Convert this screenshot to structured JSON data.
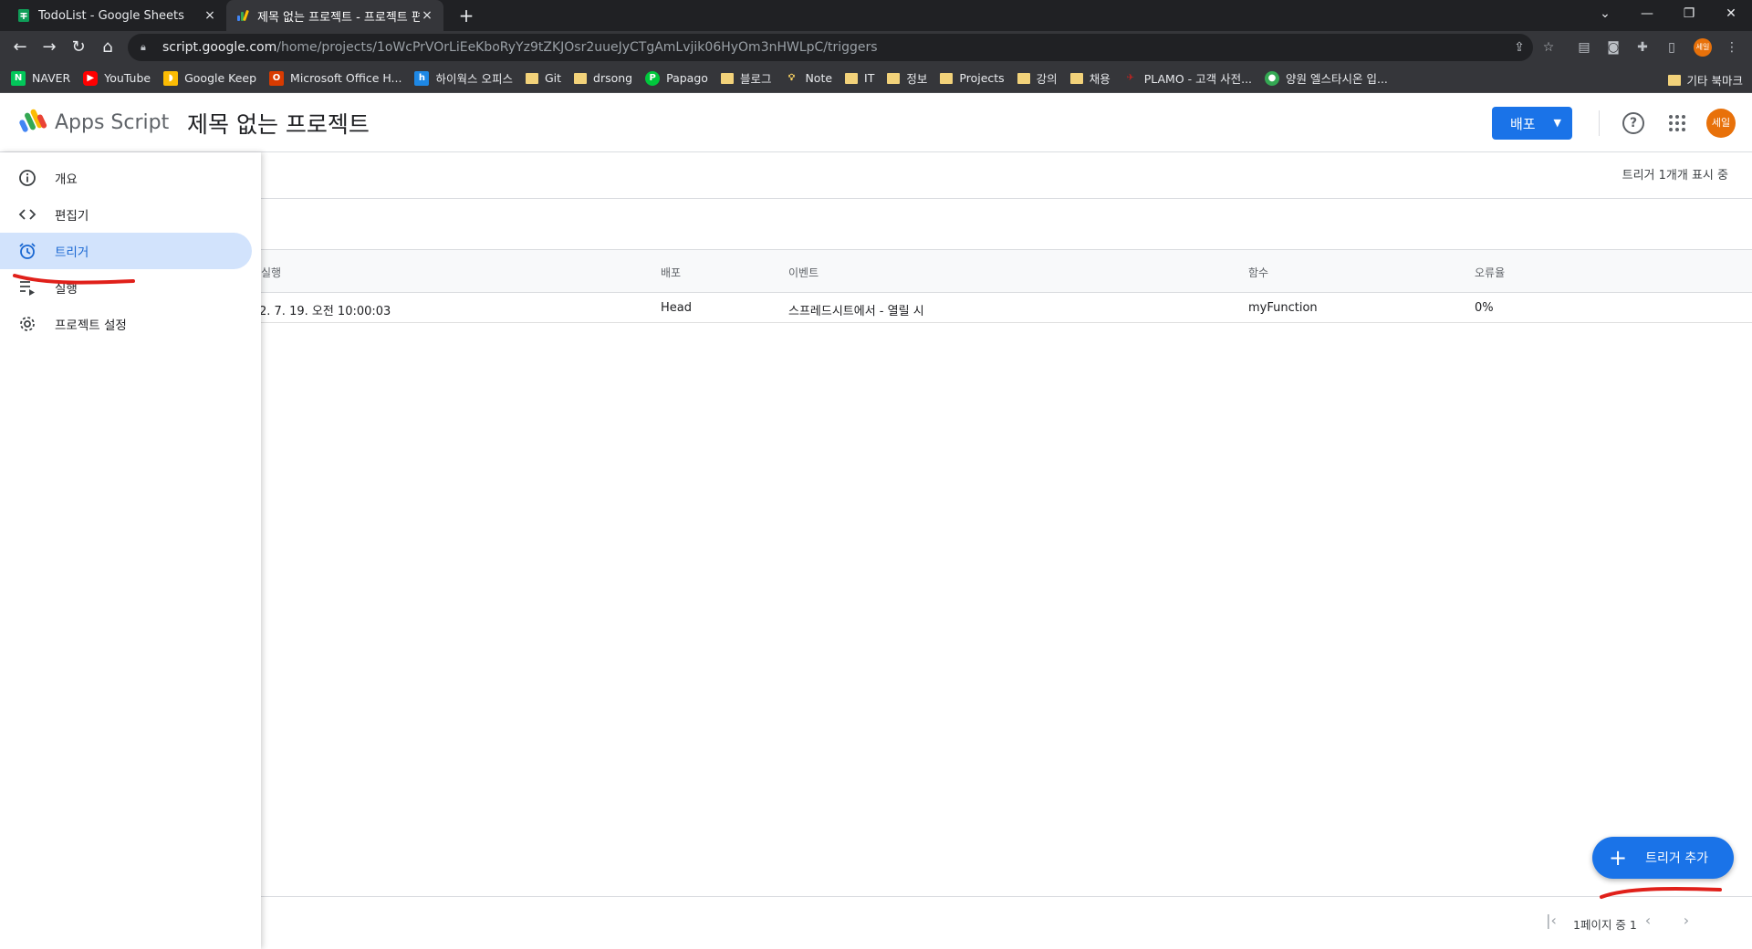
{
  "browser": {
    "tabs": [
      {
        "title": "TodoList - Google Sheets",
        "close": "×"
      },
      {
        "title": "제목 없는 프로젝트 - 프로젝트 편",
        "close": "×"
      }
    ],
    "new_tab": "+",
    "window_controls": [
      "⌄",
      "—",
      "❐",
      "✕"
    ],
    "url_host": "script.google.com",
    "url_path": "/home/projects/1oWcPrVOrLiEeKboRyYz9tZKJOsr2uueJyCTgAmLvjik06HyOm3nHWLpC/triggers",
    "profile_label": "세일",
    "bookmarks": [
      {
        "label": "NAVER",
        "icon": "naver-icon"
      },
      {
        "label": "YouTube",
        "icon": "youtube-icon"
      },
      {
        "label": "Google Keep",
        "icon": "keep-icon"
      },
      {
        "label": "Microsoft Office H...",
        "icon": "office-icon"
      },
      {
        "label": "하이웍스 오피스",
        "icon": "hiworks-icon"
      },
      {
        "label": "Git",
        "icon": "folder-icon"
      },
      {
        "label": "drsong",
        "icon": "folder-icon"
      },
      {
        "label": "Papago",
        "icon": "papago-icon"
      },
      {
        "label": "블로그",
        "icon": "folder-icon"
      },
      {
        "label": "Note",
        "icon": "bulb-icon"
      },
      {
        "label": "IT",
        "icon": "folder-icon"
      },
      {
        "label": "정보",
        "icon": "folder-icon"
      },
      {
        "label": "Projects",
        "icon": "folder-icon"
      },
      {
        "label": "강의",
        "icon": "folder-icon"
      },
      {
        "label": "채용",
        "icon": "folder-icon"
      },
      {
        "label": "PLAMO - 고객 사전...",
        "icon": "plamo-icon"
      },
      {
        "label": "양원 엘스타시온 입...",
        "icon": "app-icon"
      }
    ],
    "other_bookmarks": "기타 북마크"
  },
  "app": {
    "name": "Apps Script",
    "project_title": "제목 없는 프로젝트",
    "deploy_label": "배포",
    "avatar_label": "세일"
  },
  "sidebar": {
    "items": [
      {
        "label": "개요",
        "icon": "info-icon"
      },
      {
        "label": "편집기",
        "icon": "code-icon"
      },
      {
        "label": "트리거",
        "icon": "alarm-icon"
      },
      {
        "label": "실행",
        "icon": "executions-icon"
      },
      {
        "label": "프로젝트 설정",
        "icon": "gear-icon"
      }
    ]
  },
  "triggers": {
    "count_label": "트리거 1개개 표시 중",
    "columns": [
      "실행",
      "배포",
      "이벤트",
      "함수",
      "오류율"
    ],
    "rows": [
      [
        "2. 7. 19. 오전 10:00:03",
        "Head",
        "스프레드시트에서 - 열릴 시",
        "myFunction",
        "0%"
      ]
    ],
    "add_button": "트리거 추가",
    "pager_label": "1페이지 중 1"
  },
  "colors": {
    "primary": "#1a73e8",
    "active_nav_bg": "#d2e3fc",
    "annotation_red": "#e0201a",
    "avatar": "#e8710a"
  }
}
